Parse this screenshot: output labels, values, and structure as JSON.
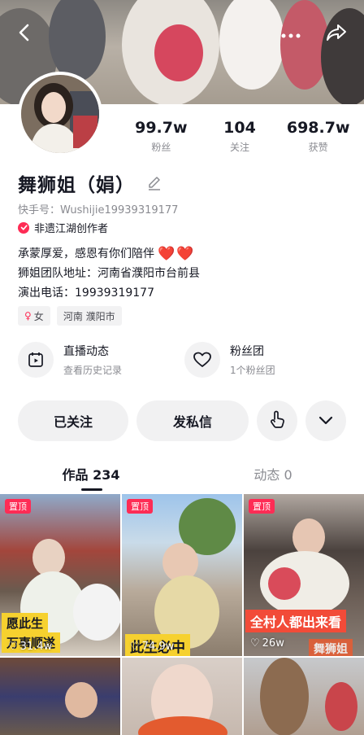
{
  "header": {
    "back_icon": "chevron-left-icon",
    "more_icon": "more-dots-icon",
    "share_icon": "share-arrow-icon"
  },
  "profile": {
    "stats": [
      {
        "value": "99.7w",
        "label": "粉丝"
      },
      {
        "value": "104",
        "label": "关注"
      },
      {
        "value": "698.7w",
        "label": "获赞"
      }
    ],
    "name": "舞狮姐（娟）",
    "kuaishou_id": "快手号：Wushijie19939319177",
    "creator_badge": "非遗江湖创作者",
    "bio": [
      "承蒙厚爱，感恩有你们陪伴",
      "狮姐团队地址：河南省濮阳市台前县",
      "演出电话：19939319177"
    ],
    "bio_emoji": "❤️❤️",
    "tags": [
      {
        "icon": "female-icon",
        "symbol": "♀",
        "label": "女"
      },
      {
        "label": "河南 濮阳市"
      }
    ]
  },
  "features": [
    {
      "icon": "live-calendar-icon",
      "title": "直播动态",
      "subtitle": "查看历史记录"
    },
    {
      "icon": "fan-club-heart-icon",
      "title": "粉丝团",
      "subtitle": "1个粉丝团"
    }
  ],
  "actions": {
    "follow_label": "已关注",
    "message_label": "发私信",
    "gesture_icon": "tap-hand-icon",
    "expand_icon": "chevron-down-icon"
  },
  "tabs": [
    {
      "label": "作品 234",
      "active": true
    },
    {
      "label": "动态 0",
      "active": false
    }
  ],
  "videos": [
    {
      "pinned": "置顶",
      "caption1": "愿此生",
      "caption2": "万事顺遂",
      "likes": "31.4w"
    },
    {
      "pinned": "置顶",
      "caption": "此生必中",
      "likes": "74.9w"
    },
    {
      "pinned": "置顶",
      "caption": "全村人都出来看",
      "watermark": "舞狮姐",
      "likes": "26w"
    },
    {},
    {},
    {}
  ],
  "colors": {
    "accent": "#fe2c55",
    "text": "#161823",
    "muted": "#8a8b91",
    "button_bg": "#f1f1f2"
  }
}
